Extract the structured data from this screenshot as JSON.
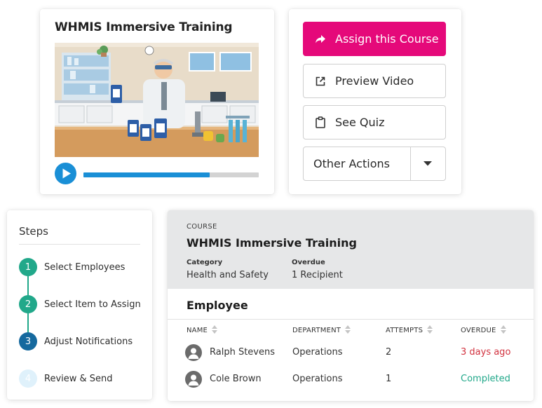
{
  "video": {
    "title": "WHMIS Immersive Training",
    "progress": 0.72,
    "play_icon": "play-icon"
  },
  "actions": {
    "assign_label": "Assign this Course",
    "preview_label": "Preview Video",
    "quiz_label": "See Quiz",
    "other_label": "Other Actions",
    "assign_color": "#e5097a"
  },
  "steps": {
    "title": "Steps",
    "items": [
      {
        "number": "1",
        "label": "Select Employees",
        "color": "#21a88a"
      },
      {
        "number": "2",
        "label": "Select Item to Assign",
        "color": "#21a88a"
      },
      {
        "number": "3",
        "label": "Adjust Notifications",
        "color": "#15699e"
      },
      {
        "number": "4",
        "label": "Review & Send",
        "color": "#dff1fb"
      }
    ]
  },
  "course": {
    "kicker": "COURSE",
    "name": "WHMIS Immersive Training",
    "category_label": "Category",
    "category_value": "Health and Safety",
    "overdue_label": "Overdue",
    "overdue_value": "1 Recipient"
  },
  "employees": {
    "title": "Employee",
    "columns": [
      "NAME",
      "DEPARTMENT",
      "ATTEMPTS",
      "OVERDUE"
    ],
    "rows": [
      {
        "name": "Ralph Stevens",
        "department": "Operations",
        "attempts": "2",
        "overdue": "3 days ago",
        "overdue_color": "#d2323f"
      },
      {
        "name": "Cole Brown",
        "department": "Operations",
        "attempts": "1",
        "overdue": "Completed",
        "overdue_color": "#21a88a"
      }
    ]
  }
}
